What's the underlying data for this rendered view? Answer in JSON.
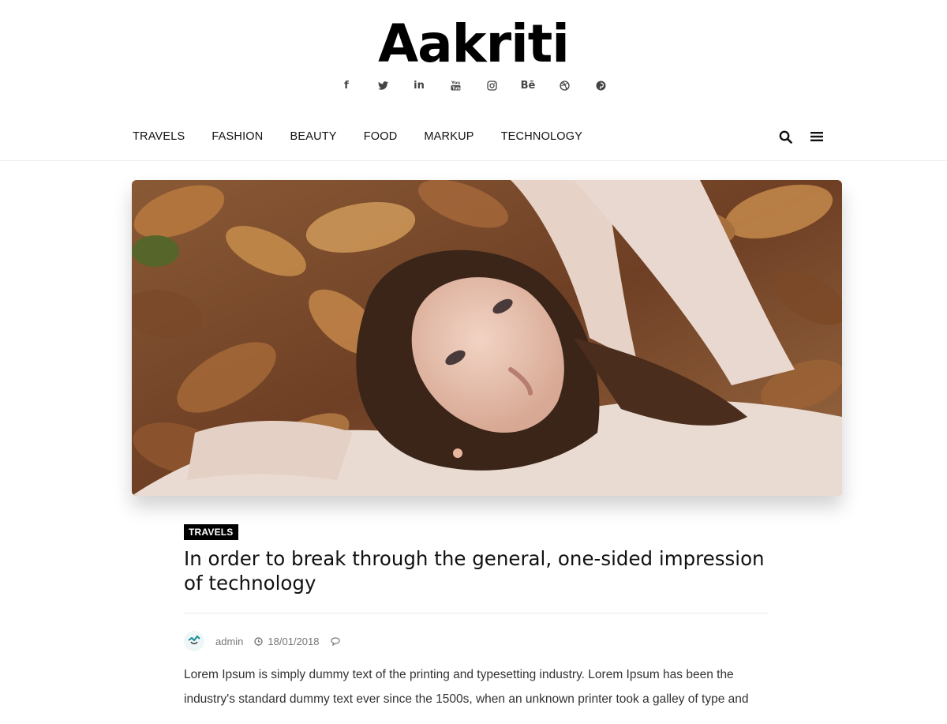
{
  "site": {
    "logo": "Aakriti"
  },
  "social": [
    {
      "name": "facebook-icon",
      "glyph": "f"
    },
    {
      "name": "twitter-icon"
    },
    {
      "name": "linkedin-icon",
      "glyph": "in"
    },
    {
      "name": "youtube-icon"
    },
    {
      "name": "instagram-icon"
    },
    {
      "name": "behance-icon",
      "glyph": "Bē"
    },
    {
      "name": "dribbble-icon"
    },
    {
      "name": "pinterest-icon"
    }
  ],
  "nav": {
    "items": [
      "TRAVELS",
      "FASHION",
      "BEAUTY",
      "FOOD",
      "MARKUP",
      "TECHNOLOGY"
    ]
  },
  "post": {
    "category": "TRAVELS",
    "title": "In order to break through the general, one-sided impression of technology",
    "author": "admin",
    "date": "18/01/2018",
    "excerpt": "Lorem Ipsum is simply dummy text of the printing and typesetting industry. Lorem Ipsum has been the industry's standard dummy text ever since the 1500s, when an unknown printer took a galley of type and"
  },
  "colors": {
    "accent": "#000000",
    "meta": "#777777",
    "divider": "#e8e8e8"
  }
}
